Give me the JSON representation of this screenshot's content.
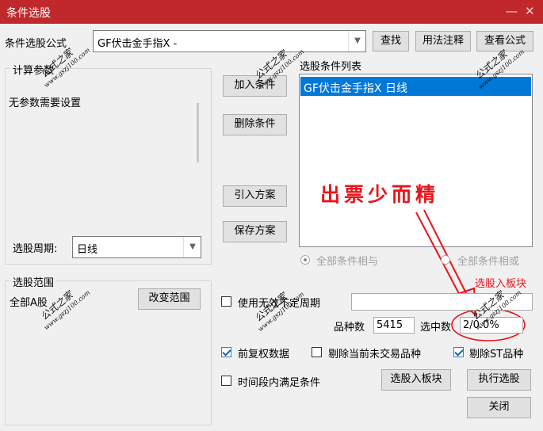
{
  "window": {
    "title": "条件选股",
    "minimize_label": "—",
    "close_label": "✕"
  },
  "formula": {
    "label": "条件选股公式",
    "value": "GF伏击金手指X  -",
    "find_button": "查找",
    "usage_button": "用法注释",
    "view_button": "查看公式"
  },
  "params": {
    "group_label": "计算参数",
    "message": "无参数需要设置"
  },
  "period": {
    "label": "选股周期:",
    "value": "日线"
  },
  "actions": {
    "add": "加入条件",
    "delete": "删除条件",
    "import": "引入方案",
    "save": "保存方案"
  },
  "conditions": {
    "label": "选股条件列表",
    "items": [
      "GF伏击金手指X  日线"
    ]
  },
  "annotation": {
    "text": "出票少而精",
    "color": "#e8151b"
  },
  "logic": {
    "and_label": "全部条件相与",
    "or_label": "全部条件相或"
  },
  "scope": {
    "group_label": "选股范围",
    "value": "全部A股",
    "change_button": "改变范围"
  },
  "stats": {
    "future_label": "选股入板块",
    "use_period_label": "使用无效不定周期",
    "count_label": "品种数",
    "count_value": "5415",
    "selected_label": "选中数",
    "selected_value": "2/0.0%"
  },
  "options": {
    "adjusted": "前复权数据",
    "exclude_untraded": "剔除当前未交易品种",
    "exclude_st": "剔除ST品种",
    "time_range": "时间段内满足条件"
  },
  "buttons": {
    "to_block": "选股入板块",
    "execute": "执行选股",
    "close": "关闭"
  },
  "watermark": {
    "text": "公式之家",
    "url": "www.gszj100.com"
  },
  "colors": {
    "titlebar": "#c0282c",
    "selection": "#0078d7",
    "annotation": "#e8151b"
  }
}
